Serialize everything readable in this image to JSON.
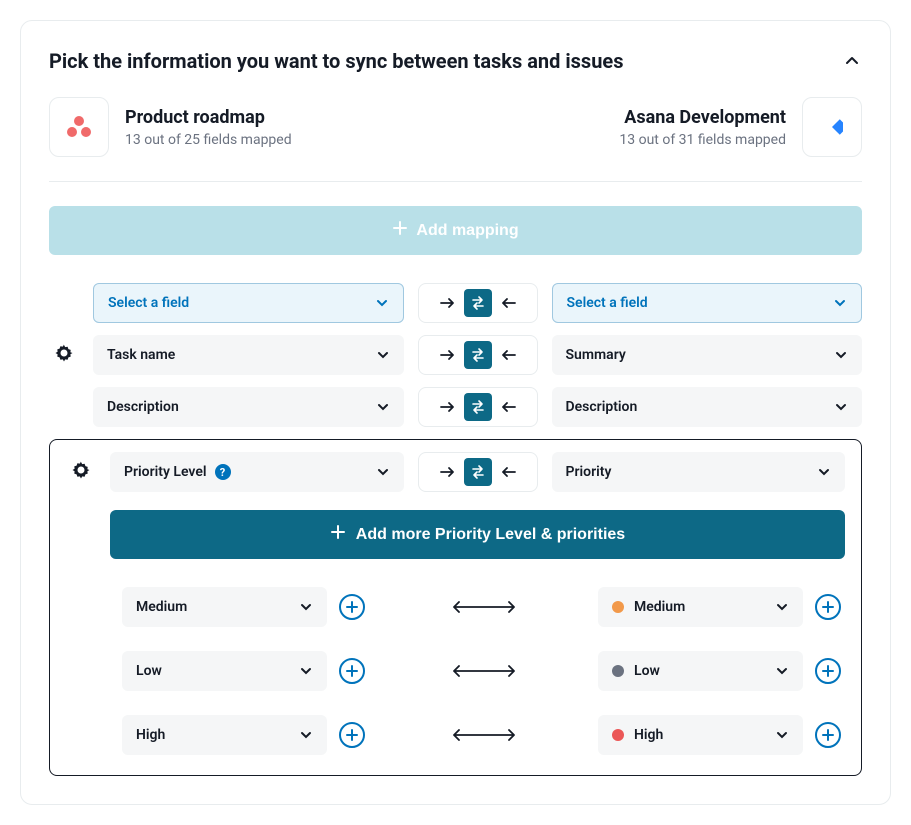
{
  "header": {
    "title": "Pick the information you want to sync between tasks and issues"
  },
  "left_app": {
    "name": "Product roadmap",
    "subtitle": "13 out of 25 fields mapped",
    "icon": "asana-icon"
  },
  "right_app": {
    "name": "Asana Development",
    "subtitle": "13 out of 31 fields mapped",
    "icon": "jira-icon"
  },
  "add_mapping_label": "Add mapping",
  "rows": {
    "select_placeholder": "Select a field",
    "taskname_left": "Task name",
    "taskname_right": "Summary",
    "description_left": "Description",
    "description_right": "Description",
    "priority_left": "Priority Level",
    "priority_right": "Priority"
  },
  "add_more_label": "Add more Priority Level & priorities",
  "values": [
    {
      "left": "Medium",
      "right": "Medium",
      "color": "#f2994a"
    },
    {
      "left": "Low",
      "right": "Low",
      "color": "#6b7280"
    },
    {
      "left": "High",
      "right": "High",
      "color": "#eb5757"
    }
  ]
}
